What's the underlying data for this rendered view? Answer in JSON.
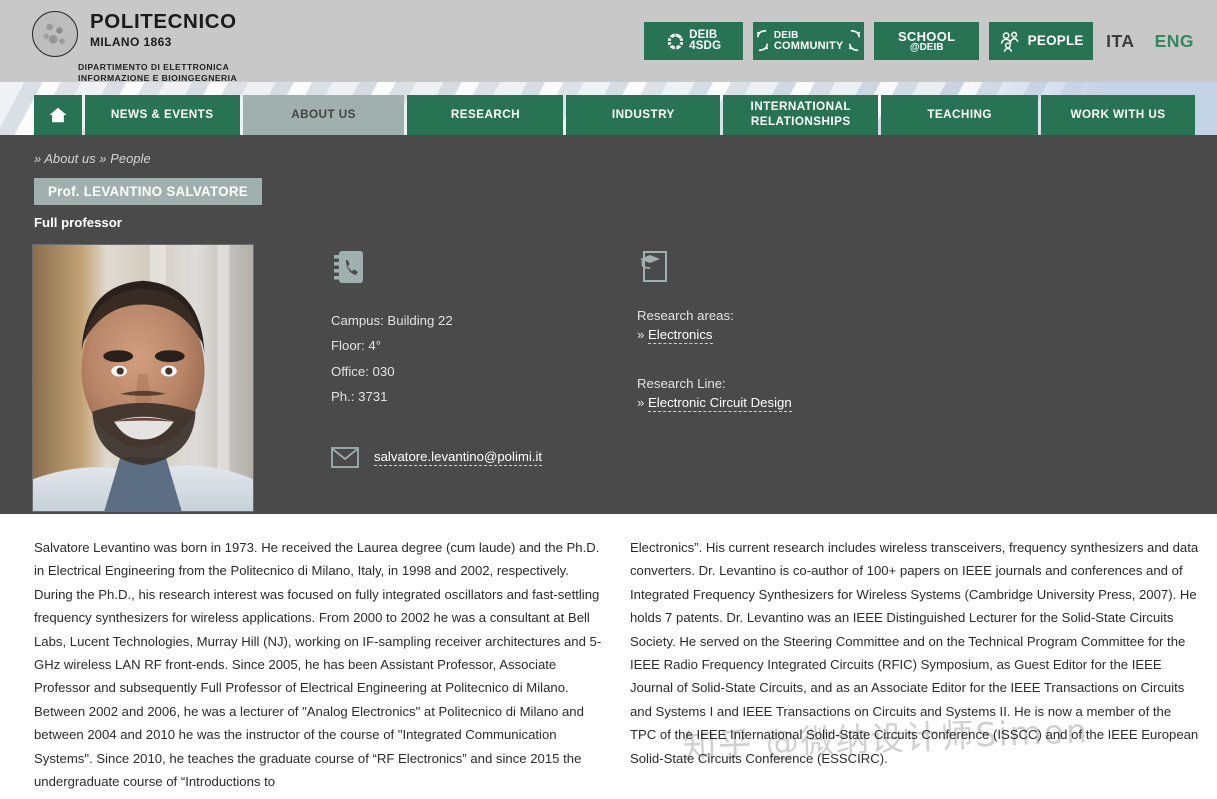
{
  "header": {
    "logo": {
      "title": "POLITECNICO",
      "subtitle": "MILANO 1863",
      "department_line1": "DIPARTIMENTO DI ELETTRONICA",
      "department_line2": "INFORMAZIONE E BIOINGEGNERIA",
      "seal_icon": "polimi-seal-icon"
    },
    "buttons": [
      {
        "id": "deib4sdg",
        "line1": "DEIB",
        "line2": "4SDG",
        "icon": "sdg-wheel-icon"
      },
      {
        "id": "deibcommunity",
        "line1": "DEIB",
        "line2": "COMMUNITY",
        "icon": "community-arrows-icon"
      },
      {
        "id": "schooldeib",
        "line1": "SCHOOL",
        "line2": "@DEIB",
        "icon": ""
      },
      {
        "id": "people",
        "line1": "",
        "line2": "PEOPLE",
        "icon": "people-group-icon"
      }
    ],
    "languages": [
      {
        "code": "ITA",
        "active": false
      },
      {
        "code": "ENG",
        "active": true
      }
    ],
    "colors": {
      "brand_green": "#277354",
      "header_bg": "#c8c8c8",
      "active_lang": "#2f8a60"
    }
  },
  "nav": {
    "home_icon": "home-icon",
    "items": [
      {
        "label": "NEWS & EVENTS",
        "active": false
      },
      {
        "label": "ABOUT US",
        "active": true
      },
      {
        "label": "RESEARCH",
        "active": false
      },
      {
        "label": "INDUSTRY",
        "active": false
      },
      {
        "label": "INTERNATIONAL RELATIONSHIPS",
        "active": false,
        "line1": "INTERNATIONAL",
        "line2": "RELATIONSHIPS"
      },
      {
        "label": "TEACHING",
        "active": false
      },
      {
        "label": "WORK WITH US",
        "active": false
      }
    ],
    "colors": {
      "inactive_bg": "#277354",
      "active_bg": "#9fb0ae",
      "active_text": "#434443"
    }
  },
  "page": {
    "breadcrumb": "» About us » People",
    "breadcrumb_parts": [
      "» About us",
      "» People"
    ],
    "person_name": "Prof. LEVANTINO SALVATORE",
    "role": "Full professor",
    "photo_alt": "portrait-photo",
    "background": "#4a4a4a"
  },
  "contact": {
    "icon": "phonebook-icon",
    "campus": "Campus: Building 22",
    "floor": "Floor: 4°",
    "office": "Office: 030",
    "phone": "Ph.: 3731",
    "email_icon": "envelope-icon",
    "email": "salvatore.levantino@polimi.it"
  },
  "research": {
    "icon": "graduation-document-icon",
    "areas_label": "Research areas:",
    "areas": [
      "Electronics"
    ],
    "line_label": "Research Line:",
    "lines": [
      "Electronic Circuit Design"
    ],
    "bullet": "»"
  },
  "biography": {
    "left": "Salvatore Levantino was born in 1973. He received the Laurea degree (cum laude) and the Ph.D. in Electrical Engineering from the Politecnico di Milano, Italy, in 1998 and 2002, respectively. During the Ph.D., his research interest was focused on fully integrated oscillators and fast-settling frequency synthesizers for wireless applications. From 2000 to 2002 he was a consultant at Bell Labs, Lucent Technologies, Murray Hill (NJ), working on IF-sampling receiver architectures and 5-GHz wireless LAN RF front-ends. Since 2005, he has been Assistant Professor, Associate Professor and subsequently Full Professor of Electrical Engineering at Politecnico di Milano. Between 2002 and 2006, he was a lecturer of \"Analog Electronics\" at Politecnico di Milano and between 2004 and 2010 he was the instructor of the course of \"Integrated Communication Systems\". Since 2010, he teaches the graduate course of “RF Electronics” and since 2015 the undergraduate course of “Introductions to",
    "right": "Electronics”. His current research includes wireless transceivers, frequency synthesizers and data converters. Dr. Levantino is co-author of 100+ papers on IEEE journals and conferences and of Integrated Frequency Synthesizers for Wireless Systems (Cambridge University Press, 2007). He holds 7 patents. Dr. Levantino was an IEEE Distinguished Lecturer for the Solid-State Circuits Society. He served on the Steering Committee and on the Technical Program Committee for the IEEE Radio Frequency Integrated Circuits (RFIC) Symposium, as Guest Editor for the IEEE Journal of Solid-State Circuits, and as an Associate Editor for the IEEE Transactions on Circuits and Systems I and IEEE Transactions on Circuits and Systems II. He is now a member of the TPC of the IEEE International Solid-State Circuits Conference (ISSCC) and of the IEEE European Solid-State Circuits Conference (ESSCIRC)."
  },
  "watermark": {
    "text": "知乎 @微纳设计师Simon"
  }
}
